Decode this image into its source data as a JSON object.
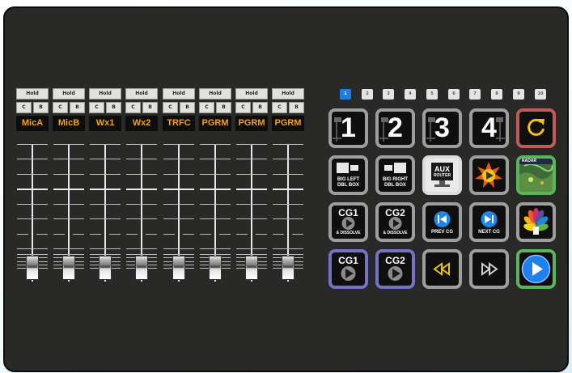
{
  "mixer": {
    "channels": [
      {
        "hold": "Hold",
        "c": "C",
        "b": "B",
        "name": "MicA",
        "level": 0.0
      },
      {
        "hold": "Hold",
        "c": "C",
        "b": "B",
        "name": "MicB",
        "level": 0.0
      },
      {
        "hold": "Hold",
        "c": "C",
        "b": "B",
        "name": "Wx1",
        "level": 0.0
      },
      {
        "hold": "Hold",
        "c": "C",
        "b": "B",
        "name": "Wx2",
        "level": 0.0
      },
      {
        "hold": "Hold",
        "c": "C",
        "b": "B",
        "name": "TRFC",
        "level": 0.0
      },
      {
        "hold": "Hold",
        "c": "C",
        "b": "B",
        "name": "PGRM",
        "level": 0.0
      },
      {
        "hold": "Hold",
        "c": "C",
        "b": "B",
        "name": "PGRM",
        "level": 0.0
      },
      {
        "hold": "Hold",
        "c": "C",
        "b": "B",
        "name": "PGRM",
        "level": 0.0
      }
    ]
  },
  "pages": {
    "tabs": [
      "1",
      "2",
      "3",
      "4",
      "5",
      "6",
      "7",
      "8",
      "9",
      "10"
    ],
    "active": "1"
  },
  "buttons": {
    "cam1": "1",
    "cam2": "2",
    "cam3": "3",
    "cam4": "4",
    "big_left": {
      "line1": "BIG LEFT",
      "line2": "DBL BOX"
    },
    "big_right": {
      "line1": "BIG RIGHT",
      "line2": "DBL BOX"
    },
    "aux_router": {
      "line1": "AUX",
      "line2": "ROUTER"
    },
    "map_label": "RADAR",
    "cg1_dissolve": {
      "top": "CG1",
      "bottom": "& DISSOLVE"
    },
    "cg2_dissolve": {
      "top": "CG2",
      "bottom": "& DISSOLVE"
    },
    "prev_cg": "PREV CG",
    "next_cg": "NEXT CG",
    "cg1": "CG1",
    "cg2": "CG2"
  },
  "colors": {
    "panel_bg": "#292a27",
    "channel_label": "#f4a21a",
    "active_tab": "#1f7fe0",
    "red_border": "#c25a5a",
    "green_border": "#5cb55a",
    "purple_border": "#7472c6",
    "play_blue": "#1e7ff0"
  }
}
